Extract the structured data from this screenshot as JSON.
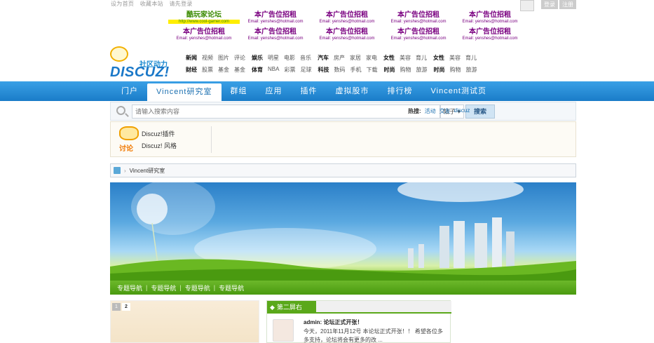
{
  "topbar": {
    "links": [
      "设为首页",
      "收藏本站",
      "请先登录"
    ],
    "login_label": "登录",
    "register_label": "注册"
  },
  "ads": [
    {
      "title": "酷玩家论坛",
      "email": "http://www.cool-gamer.com",
      "style": "green"
    },
    {
      "title": "本广告位招租",
      "email": "Email: yenshes@hotmail.com"
    },
    {
      "title": "本广告位招租",
      "email": "Email: yenshes@hotmail.com"
    },
    {
      "title": "本广告位招租",
      "email": "Email: yenshes@hotmail.com"
    },
    {
      "title": "本广告位招租",
      "email": "Email: yenshes@hotmail.com"
    },
    {
      "title": "本广告位招租",
      "email": "Email: yenshes@hotmail.com"
    },
    {
      "title": "本广告位招租",
      "email": "Email: yenshes@hotmail.com"
    },
    {
      "title": "本广告位招租",
      "email": "Email: yenshes@hotmail.com"
    },
    {
      "title": "本广告位招租",
      "email": "Email: yenshes@hotmail.com"
    },
    {
      "title": "本广告位招租",
      "email": "Email: yenshes@hotmail.com"
    }
  ],
  "logo": {
    "tagline": "社区动力",
    "wordmark": "DISCUZ!"
  },
  "catnav": {
    "row1": [
      {
        "head": "新闻",
        "items": [
          "视频",
          "图片",
          "评论"
        ]
      },
      {
        "head": "娱乐",
        "items": [
          "明星",
          "电影",
          "音乐"
        ]
      },
      {
        "head": "汽车",
        "items": [
          "房产",
          "家居",
          "家电"
        ]
      },
      {
        "head": "女性",
        "items": [
          "美容",
          "育儿"
        ]
      },
      {
        "head": "女性",
        "items": [
          "美容",
          "育儿"
        ]
      }
    ],
    "row2": [
      {
        "head": "财经",
        "items": [
          "股票",
          "基金",
          "基金"
        ]
      },
      {
        "head": "体育",
        "items": [
          "NBA",
          "彩票",
          "足球"
        ]
      },
      {
        "head": "科技",
        "items": [
          "数码",
          "手机",
          "下载"
        ]
      },
      {
        "head": "时尚",
        "items": [
          "购物",
          "旅游"
        ]
      },
      {
        "head": "时尚",
        "items": [
          "购物",
          "旅游"
        ]
      }
    ]
  },
  "mainnav": {
    "items": [
      "门户",
      "Vincent研究室",
      "群组",
      "应用",
      "插件",
      "虚拟股市",
      "排行榜",
      "Vincent测试页"
    ],
    "active_index": 1
  },
  "search": {
    "placeholder": "请输入搜索内容",
    "type_label": "帖子",
    "button_label": "搜索",
    "hot_label": "热搜:",
    "hot_words": [
      "活动",
      "交友",
      "discuz"
    ]
  },
  "forum_box": {
    "icon_text": "讨论",
    "links": [
      "Discuz!插件",
      "Discuz! 风格"
    ]
  },
  "breadcrumb": {
    "current": "Vincent研究室"
  },
  "subnav": {
    "items": [
      "专题导航",
      "专题导航",
      "专题导航",
      "专题导航"
    ]
  },
  "slide": {
    "pages": [
      "1",
      "2"
    ],
    "active_page": 2
  },
  "box2": {
    "tab_label": "第二屏右",
    "post_title": "admin: 论坛正式开张！",
    "post_text": "今天，2011年11月12号 本论坛正式开张！！ 希望各位多多支持，论坛将会有更多的改 ..."
  },
  "colors": {
    "nav_blue": "#1a7cc8",
    "brand_green": "#5aa81a",
    "ad_purple": "#7a0080"
  }
}
